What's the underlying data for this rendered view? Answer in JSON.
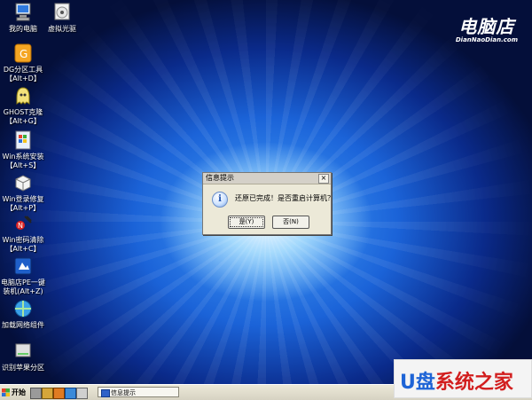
{
  "desktop": {
    "icons": [
      {
        "label": "我的电脑",
        "sub": "",
        "icon": "computer-icon"
      },
      {
        "label": "虚拟光驱",
        "sub": "",
        "icon": "cd-drive-icon"
      },
      {
        "label": "DG分区工具",
        "sub": "【Alt+D】",
        "icon": "partition-tool-icon"
      },
      {
        "label": "GHOST克隆",
        "sub": "【Alt+G】",
        "icon": "ghost-icon"
      },
      {
        "label": "Win系统安装",
        "sub": "【Alt+S】",
        "icon": "win-install-icon"
      },
      {
        "label": "Win登录修复",
        "sub": "【Alt+P】",
        "icon": "win-login-fix-icon"
      },
      {
        "label": "Win密码清除",
        "sub": "【Alt+C】",
        "icon": "password-clear-icon"
      },
      {
        "label": "电脑店PE一键",
        "sub": "装机(Alt+Z)",
        "icon": "one-click-install-icon"
      },
      {
        "label": "加载网络组件",
        "sub": "",
        "icon": "network-icon"
      },
      {
        "label": "识别苹果分区",
        "sub": "",
        "icon": "apple-partition-icon"
      }
    ]
  },
  "brand": {
    "name": "电脑店",
    "url": "DianNaoDian.com"
  },
  "dialog": {
    "title": "信息提示",
    "close": "×",
    "message": "还原已完成！是否重启计算机？",
    "yes_label": "是(Y)",
    "no_label": "否(N)"
  },
  "taskbar": {
    "start_label": "开始",
    "task_label": "信息提示"
  },
  "watermark": {
    "text": "U盘系统之家",
    "colors": {
      "u": "#1e64d6",
      "pan": "#1e64d6",
      "rest": "#d21e1e"
    }
  }
}
